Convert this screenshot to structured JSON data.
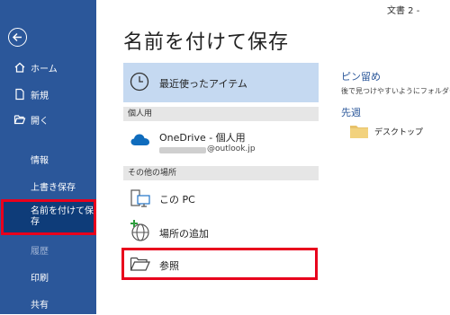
{
  "window": {
    "doc_title": "文書 2 -"
  },
  "sidebar": {
    "items": [
      {
        "label": "ホーム"
      },
      {
        "label": "新規"
      },
      {
        "label": "開く"
      },
      {
        "label": "情報"
      },
      {
        "label": "上書き保存"
      },
      {
        "label": "名前を付けて保\n存"
      },
      {
        "label": "履歴"
      },
      {
        "label": "印刷"
      },
      {
        "label": "共有"
      }
    ]
  },
  "main": {
    "title": "名前を付けて保存",
    "recent_label": "最近使ったアイテム",
    "section_personal": "個人用",
    "onedrive_label": "OneDrive - 個人用",
    "onedrive_account": "@outlook.jp",
    "section_other": "その他の場所",
    "thispc_label": "この PC",
    "addplace_label": "場所の追加",
    "browse_label": "参照"
  },
  "right": {
    "pinned_heading": "ピン留め",
    "pinned_hint": "後で見つけやすいようにフォルダーを",
    "lastweek_heading": "先週",
    "folder_label": "デスクトップ"
  },
  "colors": {
    "sidebar": "#2b579a",
    "selected": "#0e3c79",
    "highlight": "#e8001c",
    "recent_bg": "#c5d9f1",
    "accent": "#2b579a"
  }
}
